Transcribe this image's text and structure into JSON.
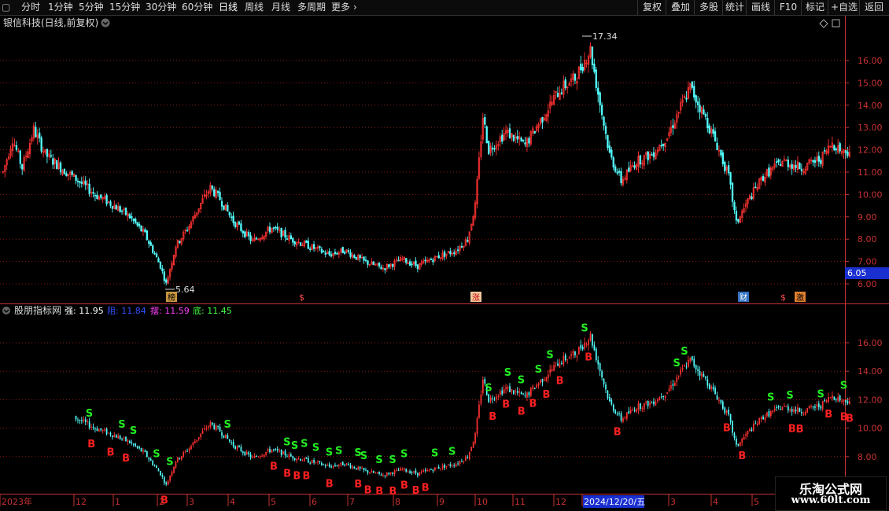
{
  "toolbar": {
    "periods": [
      "分时",
      "1分钟",
      "5分钟",
      "15分钟",
      "30分钟",
      "60分钟",
      "日线",
      "周线",
      "月线",
      "多周期",
      "更多"
    ],
    "active_period": "日线",
    "right_buttons": [
      "复权",
      "叠加",
      "多股",
      "统计",
      "画线",
      "F10",
      "标记",
      "+自选",
      "返回"
    ]
  },
  "main_panel": {
    "title": "银信科技(日线,前复权)",
    "high_label": "17.34",
    "low_label": "5.64",
    "price_tag": "6.05",
    "y_ticks": [
      "16.00",
      "15.00",
      "14.00",
      "13.00",
      "12.00",
      "11.00",
      "10.00",
      "9.00",
      "8.00",
      "7.00",
      "6.00"
    ],
    "event_markers": [
      "榜",
      "$",
      "涨",
      "财",
      "$",
      "激"
    ]
  },
  "indicator_panel": {
    "name": "股朋指标网",
    "items": [
      {
        "label": "强: 11.95",
        "color": "#ffffff"
      },
      {
        "label": "阻: 11.84",
        "color": "#3050ff"
      },
      {
        "label": "摆: 11.59",
        "color": "#ff40ff"
      },
      {
        "label": "底: 11.45",
        "color": "#40ff40"
      }
    ],
    "y_ticks": [
      "16.00",
      "14.00",
      "12.00",
      "10.00",
      "8.00"
    ],
    "signal_labels": {
      "sell": "S",
      "buy": "B"
    }
  },
  "x_axis": {
    "labels": [
      "2023年",
      "12",
      "1",
      "2",
      "3",
      "4",
      "5",
      "6",
      "7",
      "8",
      "9",
      "10",
      "11",
      "12",
      "2024/12/20/五",
      "3",
      "4",
      "5"
    ]
  },
  "watermark": {
    "line1": "乐淘公式网",
    "line2": "www.60lt.com"
  },
  "colors": {
    "up": "#ff3232",
    "down": "#54ffff",
    "grid": "#8b1a1a",
    "axis": "#c83232",
    "sell": "#22ee22",
    "buy": "#ff2020"
  }
}
